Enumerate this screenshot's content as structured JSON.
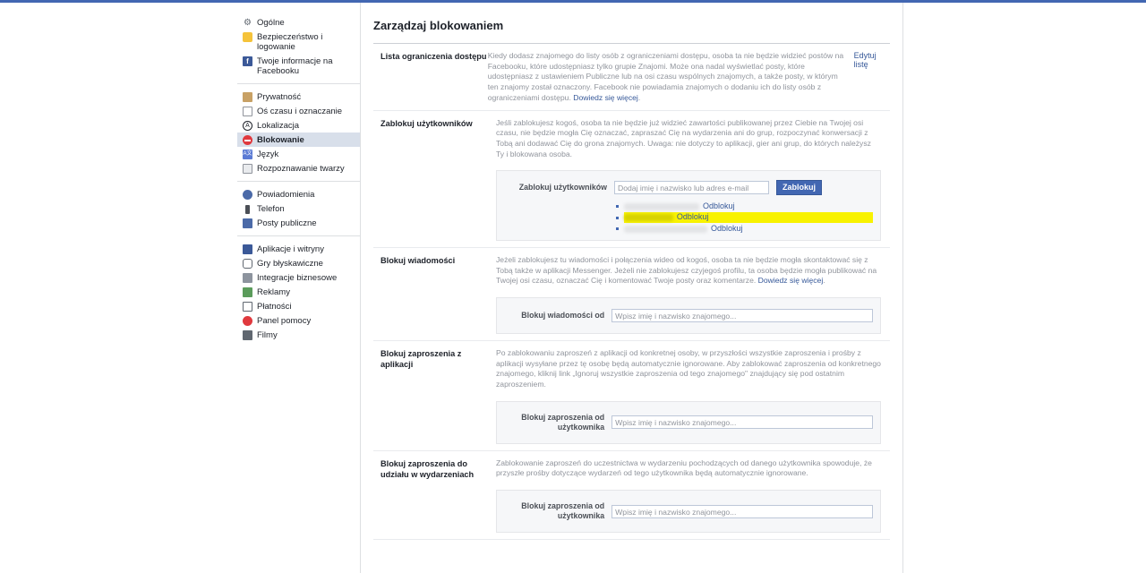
{
  "sidebar": {
    "groups": [
      [
        {
          "label": "Ogólne",
          "icon": "gear-icon"
        },
        {
          "label": "Bezpieczeństwo i logowanie",
          "icon": "shield-icon"
        },
        {
          "label": "Twoje informacje na Facebooku",
          "icon": "facebook-icon"
        }
      ],
      [
        {
          "label": "Prywatność",
          "icon": "lock-icon"
        },
        {
          "label": "Oś czasu i oznaczanie",
          "icon": "timeline-icon"
        },
        {
          "label": "Lokalizacja",
          "icon": "location-icon"
        },
        {
          "label": "Blokowanie",
          "icon": "block-icon",
          "active": true
        },
        {
          "label": "Język",
          "icon": "language-icon"
        },
        {
          "label": "Rozpoznawanie twarzy",
          "icon": "face-icon"
        }
      ],
      [
        {
          "label": "Powiadomienia",
          "icon": "globe-icon"
        },
        {
          "label": "Telefon",
          "icon": "phone-icon"
        },
        {
          "label": "Posty publiczne",
          "icon": "rss-icon"
        }
      ],
      [
        {
          "label": "Aplikacje i witryny",
          "icon": "apps-icon"
        },
        {
          "label": "Gry błyskawiczne",
          "icon": "gamepad-icon"
        },
        {
          "label": "Integracje biznesowe",
          "icon": "business-icon"
        },
        {
          "label": "Reklamy",
          "icon": "ads-icon"
        },
        {
          "label": "Płatności",
          "icon": "payment-icon"
        },
        {
          "label": "Panel pomocy",
          "icon": "help-icon"
        },
        {
          "label": "Filmy",
          "icon": "video-icon"
        }
      ]
    ]
  },
  "main": {
    "title": "Zarządzaj blokowaniem",
    "restricted": {
      "label": "Lista ograniczenia dostępu",
      "text": "Kiedy dodasz znajomego do listy osób z ograniczeniami dostępu, osoba ta nie będzie widzieć postów na Facebooku, które udostępniasz tylko grupie Znajomi. Może ona nadal wyświetlać posty, które udostępniasz z ustawieniem Publiczne lub na osi czasu wspólnych znajomych, a także posty, w którym ten znajomy został oznaczony. Facebook nie powiadamia znajomych o dodaniu ich do listy osób z ograniczeniami dostępu.",
      "learn_more": "Dowiedz się więcej",
      "action": "Edytuj listę"
    },
    "block_users": {
      "label": "Zablokuj użytkowników",
      "text": "Jeśli zablokujesz kogoś, osoba ta nie będzie już widzieć zawartości publikowanej przez Ciebie na Twojej osi czasu, nie będzie mogła Cię oznaczać, zapraszać Cię na wydarzenia ani do grup, rozpoczynać konwersacji z Tobą ani dodawać Cię do grona znajomych. Uwaga: nie dotyczy to aplikacji, gier ani grup, do których należysz Ty i blokowana osoba.",
      "panel_label": "Zablokuj użytkowników",
      "placeholder": "Dodaj imię i nazwisko lub adres e-mail",
      "button": "Zablokuj",
      "unblock": "Odblokuj"
    },
    "block_messages": {
      "label": "Blokuj wiadomości",
      "text": "Jeżeli zablokujesz tu wiadomości i połączenia wideo od kogoś, osoba ta nie będzie mogła skontaktować się z Tobą także w aplikacji Messenger. Jeżeli nie zablokujesz czyjegoś profilu, ta osoba będzie mogła publikować na Twojej osi czasu, oznaczać Cię i komentować Twoje posty oraz komentarze.",
      "learn_more": "Dowiedz się więcej",
      "panel_label": "Blokuj wiadomości od",
      "placeholder": "Wpisz imię i nazwisko znajomego..."
    },
    "block_app_invites": {
      "label": "Blokuj zaproszenia z aplikacji",
      "text": "Po zablokowaniu zaproszeń z aplikacji od konkretnej osoby, w przyszłości wszystkie zaproszenia i prośby z aplikacji wysyłane przez tę osobę będą automatycznie ignorowane. Aby zablokować zaproszenia od konkretnego znajomego, kliknij link „Ignoruj wszystkie zaproszenia od tego znajomego\" znajdujący się pod ostatnim zaproszeniem.",
      "panel_label": "Blokuj zaproszenia od użytkownika",
      "placeholder": "Wpisz imię i nazwisko znajomego..."
    },
    "block_event_invites": {
      "label": "Blokuj zaproszenia do udziału w wydarzeniach",
      "text": "Zablokowanie zaproszeń do uczestnictwa w wydarzeniu pochodzących od danego użytkownika spowoduje, że przyszłe prośby dotyczące wydarzeń od tego użytkownika będą automatycznie ignorowane.",
      "panel_label": "Blokuj zaproszenia od użytkownika",
      "placeholder": "Wpisz imię i nazwisko znajomego..."
    }
  }
}
